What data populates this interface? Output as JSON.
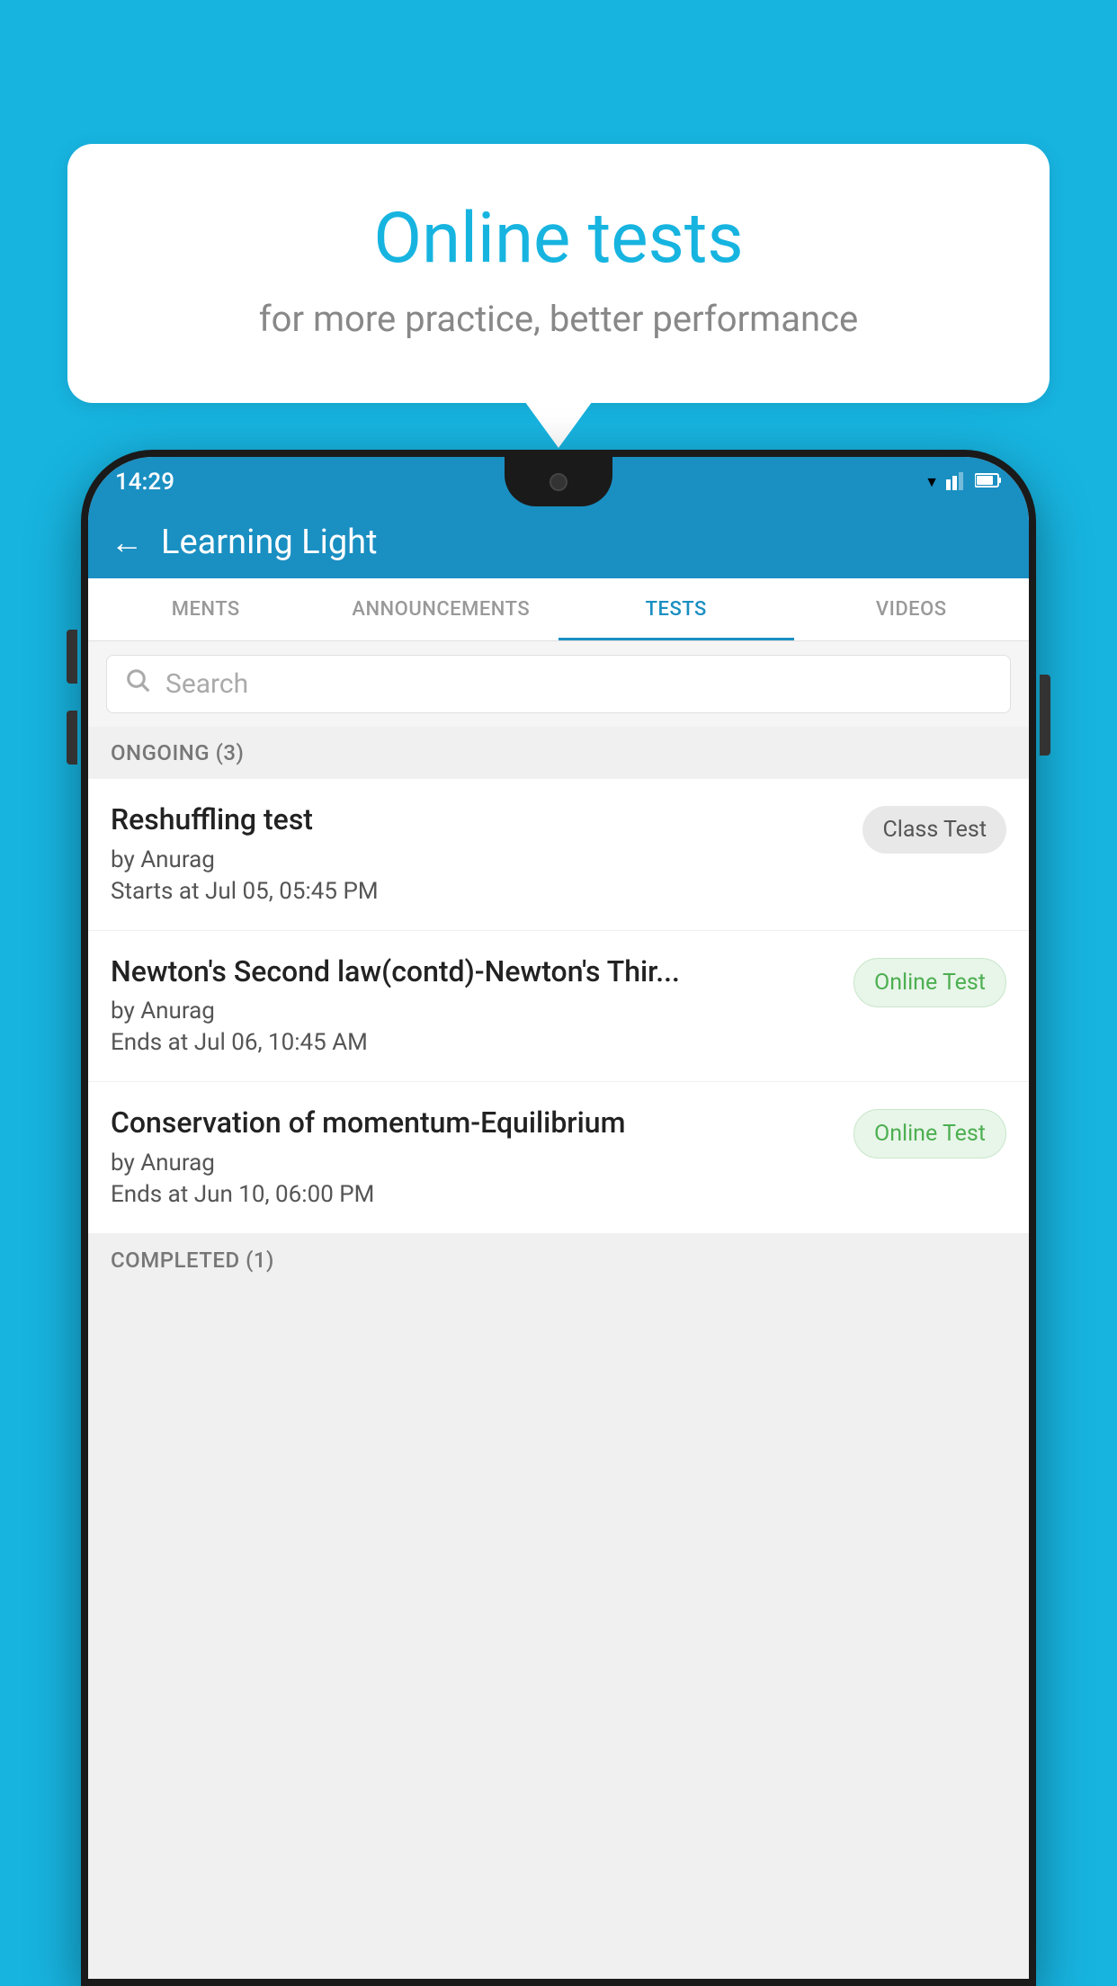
{
  "background": {
    "color": "#17b4e0"
  },
  "speech_bubble": {
    "title": "Online tests",
    "subtitle": "for more practice, better performance"
  },
  "status_bar": {
    "time": "14:29",
    "wifi": "▾",
    "signal": "▴",
    "battery": "▐"
  },
  "app_header": {
    "back_label": "←",
    "title": "Learning Light"
  },
  "tabs": [
    {
      "label": "MENTS",
      "active": false
    },
    {
      "label": "ANNOUNCEMENTS",
      "active": false
    },
    {
      "label": "TESTS",
      "active": true
    },
    {
      "label": "VIDEOS",
      "active": false
    }
  ],
  "search": {
    "placeholder": "Search"
  },
  "ongoing_section": {
    "label": "ONGOING (3)"
  },
  "test_items": [
    {
      "name": "Reshuffling test",
      "author": "by Anurag",
      "date_label": "Starts at",
      "date": "Jul 05, 05:45 PM",
      "badge": "Class Test",
      "badge_type": "class"
    },
    {
      "name": "Newton's Second law(contd)-Newton's Thir...",
      "author": "by Anurag",
      "date_label": "Ends at",
      "date": "Jul 06, 10:45 AM",
      "badge": "Online Test",
      "badge_type": "online"
    },
    {
      "name": "Conservation of momentum-Equilibrium",
      "author": "by Anurag",
      "date_label": "Ends at",
      "date": "Jun 10, 06:00 PM",
      "badge": "Online Test",
      "badge_type": "online"
    }
  ],
  "completed_section": {
    "label": "COMPLETED (1)"
  }
}
